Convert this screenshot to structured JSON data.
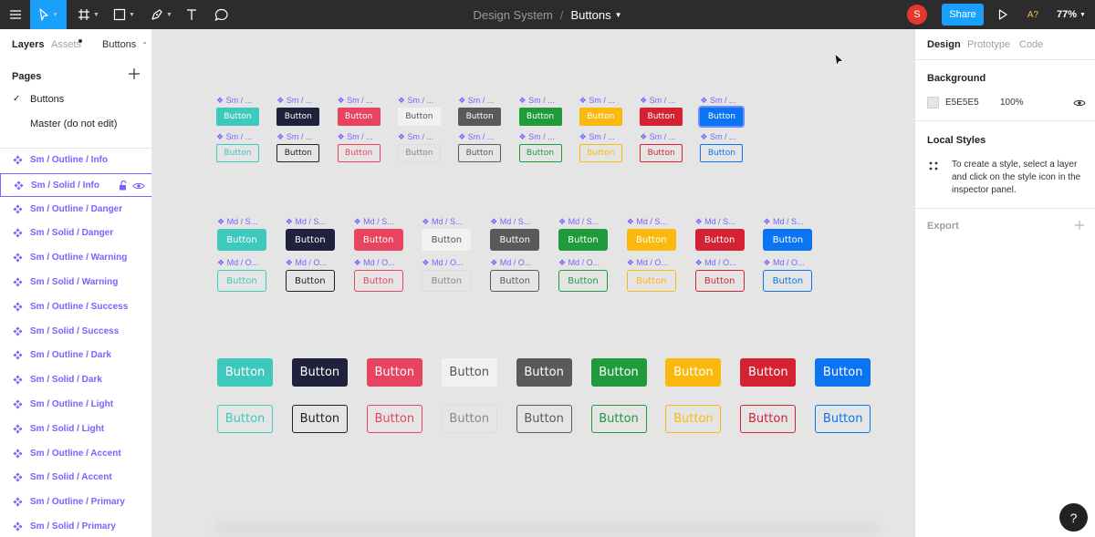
{
  "toolbar": {
    "project": "Design System",
    "separator": "/",
    "page": "Buttons",
    "user_initial": "S",
    "share_label": "Share",
    "accessibility_label": "A?",
    "zoom": "77%"
  },
  "left_panel": {
    "tabs": [
      "Layers",
      "Assets",
      "Buttons"
    ],
    "pages_title": "Pages",
    "pages": [
      {
        "label": "Buttons",
        "checked": true
      },
      {
        "label": "Master (do not edit)",
        "checked": false
      }
    ],
    "layers": [
      "Sm / Outline / Info",
      "Sm / Solid / Info",
      "Sm / Outline / Danger",
      "Sm / Solid / Danger",
      "Sm / Outline / Warning",
      "Sm / Solid / Warning",
      "Sm / Outline / Success",
      "Sm / Solid / Success",
      "Sm / Outline / Dark",
      "Sm / Solid / Dark",
      "Sm / Outline / Light",
      "Sm / Solid / Light",
      "Sm / Outline / Accent",
      "Sm / Solid / Accent",
      "Sm / Outline / Primary",
      "Sm / Solid / Primary"
    ],
    "selected_layer": "Sm / Solid / Info"
  },
  "canvas": {
    "button_label": "Button",
    "sm_label": "❖ Sm / ...",
    "md_solid_label": "❖ Md / S...",
    "md_outline_label": "❖ Md / O...",
    "variants": [
      {
        "name": "info",
        "color": "#3ec9bd"
      },
      {
        "name": "dark",
        "color": "#20213c"
      },
      {
        "name": "danger",
        "color": "#e84460"
      },
      {
        "name": "light",
        "color": "#f1f1f1"
      },
      {
        "name": "secondary",
        "color": "#5a5a5a"
      },
      {
        "name": "success",
        "color": "#1f9b3c"
      },
      {
        "name": "warning",
        "color": "#fbb80f"
      },
      {
        "name": "red",
        "color": "#d42232"
      },
      {
        "name": "primary",
        "color": "#0b74f2"
      }
    ]
  },
  "right_panel": {
    "tabs": [
      "Design",
      "Prototype",
      "Code"
    ],
    "background_title": "Background",
    "background_hex": "E5E5E5",
    "background_opacity": "100%",
    "local_styles_title": "Local Styles",
    "local_styles_hint": "To create a style, select a layer and click on the style icon in the inspector panel.",
    "export_title": "Export"
  },
  "help_label": "?"
}
